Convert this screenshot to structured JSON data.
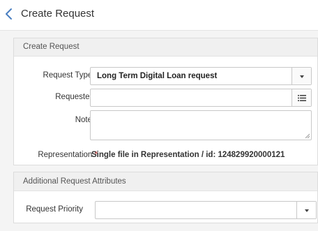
{
  "header": {
    "title": "Create Request",
    "back_icon": "chevron-left-icon"
  },
  "create_section": {
    "title": "Create Request",
    "request_type": {
      "label": "Request Type",
      "required_mark": "*",
      "value": "Long Term Digital Loan request",
      "icon": "caret-down-icon"
    },
    "requester": {
      "label": "Requester",
      "required_mark": "*",
      "value": "",
      "icon": "list-icon"
    },
    "note": {
      "label": "Note",
      "value": ""
    },
    "representation": {
      "label": "Representation",
      "required_mark": "*",
      "value": "Single file in Representation / id: 124829920000121"
    }
  },
  "additional_section": {
    "title": "Additional Request Attributes",
    "request_priority": {
      "label": "Request Priority",
      "value": "",
      "icon": "caret-down-icon"
    }
  },
  "colors": {
    "accent": "#4a7fc1",
    "required": "#d32f2f",
    "panel_header_bg": "#f0f0f0",
    "page_bg": "#f4f4f4"
  }
}
